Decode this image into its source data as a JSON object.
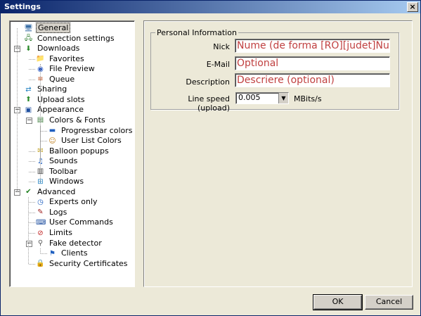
{
  "window": {
    "title": "Settings",
    "close_glyph": "×"
  },
  "tree": {
    "items": [
      {
        "label": "General",
        "icon": "computer-icon",
        "level": 0,
        "selected": true
      },
      {
        "label": "Connection settings",
        "icon": "network-icon",
        "level": 0
      },
      {
        "label": "Downloads",
        "icon": "download-icon",
        "level": 0,
        "expanded": true
      },
      {
        "label": "Favorites",
        "icon": "folder-icon",
        "level": 1
      },
      {
        "label": "File Preview",
        "icon": "preview-icon",
        "level": 1
      },
      {
        "label": "Queue",
        "icon": "queue-icon",
        "level": 1
      },
      {
        "label": "Sharing",
        "icon": "sharing-icon",
        "level": 0
      },
      {
        "label": "Upload slots",
        "icon": "upload-icon",
        "level": 0
      },
      {
        "label": "Appearance",
        "icon": "appearance-icon",
        "level": 0,
        "expanded": true
      },
      {
        "label": "Colors & Fonts",
        "icon": "colors-icon",
        "level": 1,
        "expanded": true
      },
      {
        "label": "Progressbar colors",
        "icon": "progressbar-icon",
        "level": 2
      },
      {
        "label": "User List Colors",
        "icon": "user-icon",
        "level": 2
      },
      {
        "label": "Balloon popups",
        "icon": "balloon-icon",
        "level": 1
      },
      {
        "label": "Sounds",
        "icon": "sound-icon",
        "level": 1
      },
      {
        "label": "Toolbar",
        "icon": "toolbar-icon",
        "level": 1
      },
      {
        "label": "Windows",
        "icon": "windows-icon",
        "level": 1
      },
      {
        "label": "Advanced",
        "icon": "checkmark-icon",
        "level": 0,
        "expanded": true
      },
      {
        "label": "Experts only",
        "icon": "clock-icon",
        "level": 1
      },
      {
        "label": "Logs",
        "icon": "logs-icon",
        "level": 1
      },
      {
        "label": "User Commands",
        "icon": "commands-icon",
        "level": 1
      },
      {
        "label": "Limits",
        "icon": "limit-icon",
        "level": 1
      },
      {
        "label": "Fake detector",
        "icon": "detector-icon",
        "level": 1,
        "expanded": true
      },
      {
        "label": "Clients",
        "icon": "clients-icon",
        "level": 2
      },
      {
        "label": "Security Certificates",
        "icon": "lock-icon",
        "level": 1
      }
    ]
  },
  "personal": {
    "group_title": "Personal Information",
    "nick_label": "Nick",
    "nick_value": "Nume (de forma [RO][judet]Nume_dorit)",
    "email_label": "E-Mail",
    "email_value": "Optional",
    "description_label": "Description",
    "description_value": "Descriere (optional)",
    "speed_label": "Line speed (upload)",
    "speed_value": "0.005",
    "speed_unit": "MBits/s"
  },
  "buttons": {
    "ok": "OK",
    "cancel": "Cancel"
  }
}
